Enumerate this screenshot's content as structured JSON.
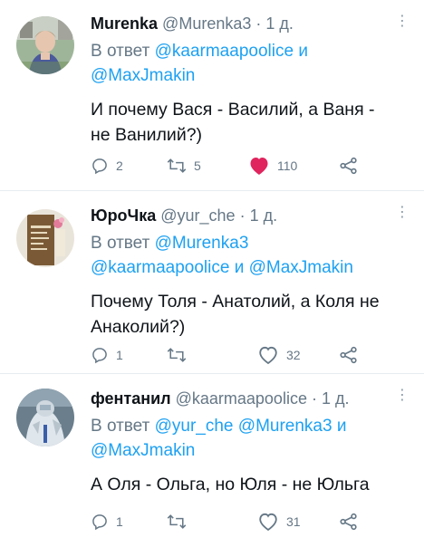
{
  "tweets": [
    {
      "display_name": "Murenka",
      "handle": "@Murenka3",
      "dot": "·",
      "time": "1 д.",
      "reply_prefix": "В ответ",
      "reply_m1": "@kaarmaapoolice",
      "reply_and": "и",
      "reply_m2": "@MaxJmakin",
      "reply_m3": "",
      "text_line1": "И почему Вася - Василий, а Ваня -",
      "text_line2": "не Ванилий?)",
      "replies": "2",
      "retweets": "5",
      "likes": "110",
      "liked": true
    },
    {
      "display_name": "ЮроЧка",
      "handle": "@yur_che",
      "dot": "·",
      "time": "1 д.",
      "reply_prefix": "В ответ",
      "reply_m1": "@Murenka3",
      "reply_m2": "@kaarmaapoolice",
      "reply_and": "и",
      "reply_m3": "@MaxJmakin",
      "text_line1": "Почему Толя - Анатолий, а Коля не",
      "text_line2": "Анаколий?)",
      "replies": "1",
      "retweets": "",
      "likes": "32",
      "liked": false
    },
    {
      "display_name": "фентанил",
      "handle": "@kaarmaapoolice",
      "dot": "·",
      "time": "1 д.",
      "reply_prefix": "В ответ",
      "reply_m1": "@yur_che",
      "reply_m2": "@Murenka3",
      "reply_and": "и",
      "reply_m3": "@MaxJmakin",
      "text_line1": "А Оля - Ольга, но Юля - не Юльга",
      "text_line2": "",
      "replies": "1",
      "retweets": "",
      "likes": "31",
      "liked": false
    }
  ],
  "colors": {
    "accent": "#1da1f2",
    "like": "#e0245e",
    "muted": "#657786",
    "text": "#0f1419"
  },
  "icons": {
    "reply": "reply-icon",
    "retweet": "retweet-icon",
    "like": "heart-icon",
    "share": "share-icon",
    "more": "more-vertical-icon"
  }
}
